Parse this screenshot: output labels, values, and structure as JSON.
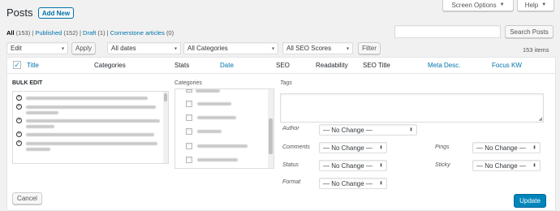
{
  "page": {
    "title": "Posts",
    "add_new": "Add New"
  },
  "top_buttons": {
    "screen_options": "Screen Options",
    "help": "Help",
    "arrow": "▼"
  },
  "filters": {
    "all": "All",
    "all_count": "(153)",
    "sep": "|",
    "published": "Published",
    "published_count": "(152)",
    "draft": "Draft",
    "draft_count": "(1)",
    "cornerstone": "Cornerstone articles",
    "cornerstone_count": "(0)"
  },
  "search": {
    "button": "Search Posts",
    "value": ""
  },
  "actions": {
    "bulk_select": "Edit",
    "apply": "Apply",
    "dates_select": "All dates",
    "categories_select": "All Categories",
    "seo_select": "All SEO Scores",
    "filter": "Filter",
    "items_count": "153 items"
  },
  "table_headers": {
    "title": "Title",
    "categories": "Categories",
    "stats": "Stats",
    "date": "Date",
    "seo": "SEO",
    "readability": "Readability",
    "seo_title": "SEO Title",
    "meta_desc": "Meta Desc.",
    "focus_kw": "Focus KW"
  },
  "bulk_edit": {
    "heading": "BULK EDIT",
    "categories_label": "Categories",
    "tags_label": "Tags",
    "author_label": "Author",
    "author_value": "— No Change —",
    "comments_label": "Comments",
    "comments_value": "— No Change —",
    "status_label": "Status",
    "status_value": "— No Change —",
    "format_label": "Format",
    "format_value": "— No Change —",
    "pings_label": "Pings",
    "pings_value": "— No Change —",
    "sticky_label": "Sticky",
    "sticky_value": "— No Change —",
    "cancel": "Cancel",
    "update": "Update"
  },
  "colors": {
    "link": "#0073aa",
    "primary": "#0085ba",
    "background": "#f1f1f1"
  }
}
